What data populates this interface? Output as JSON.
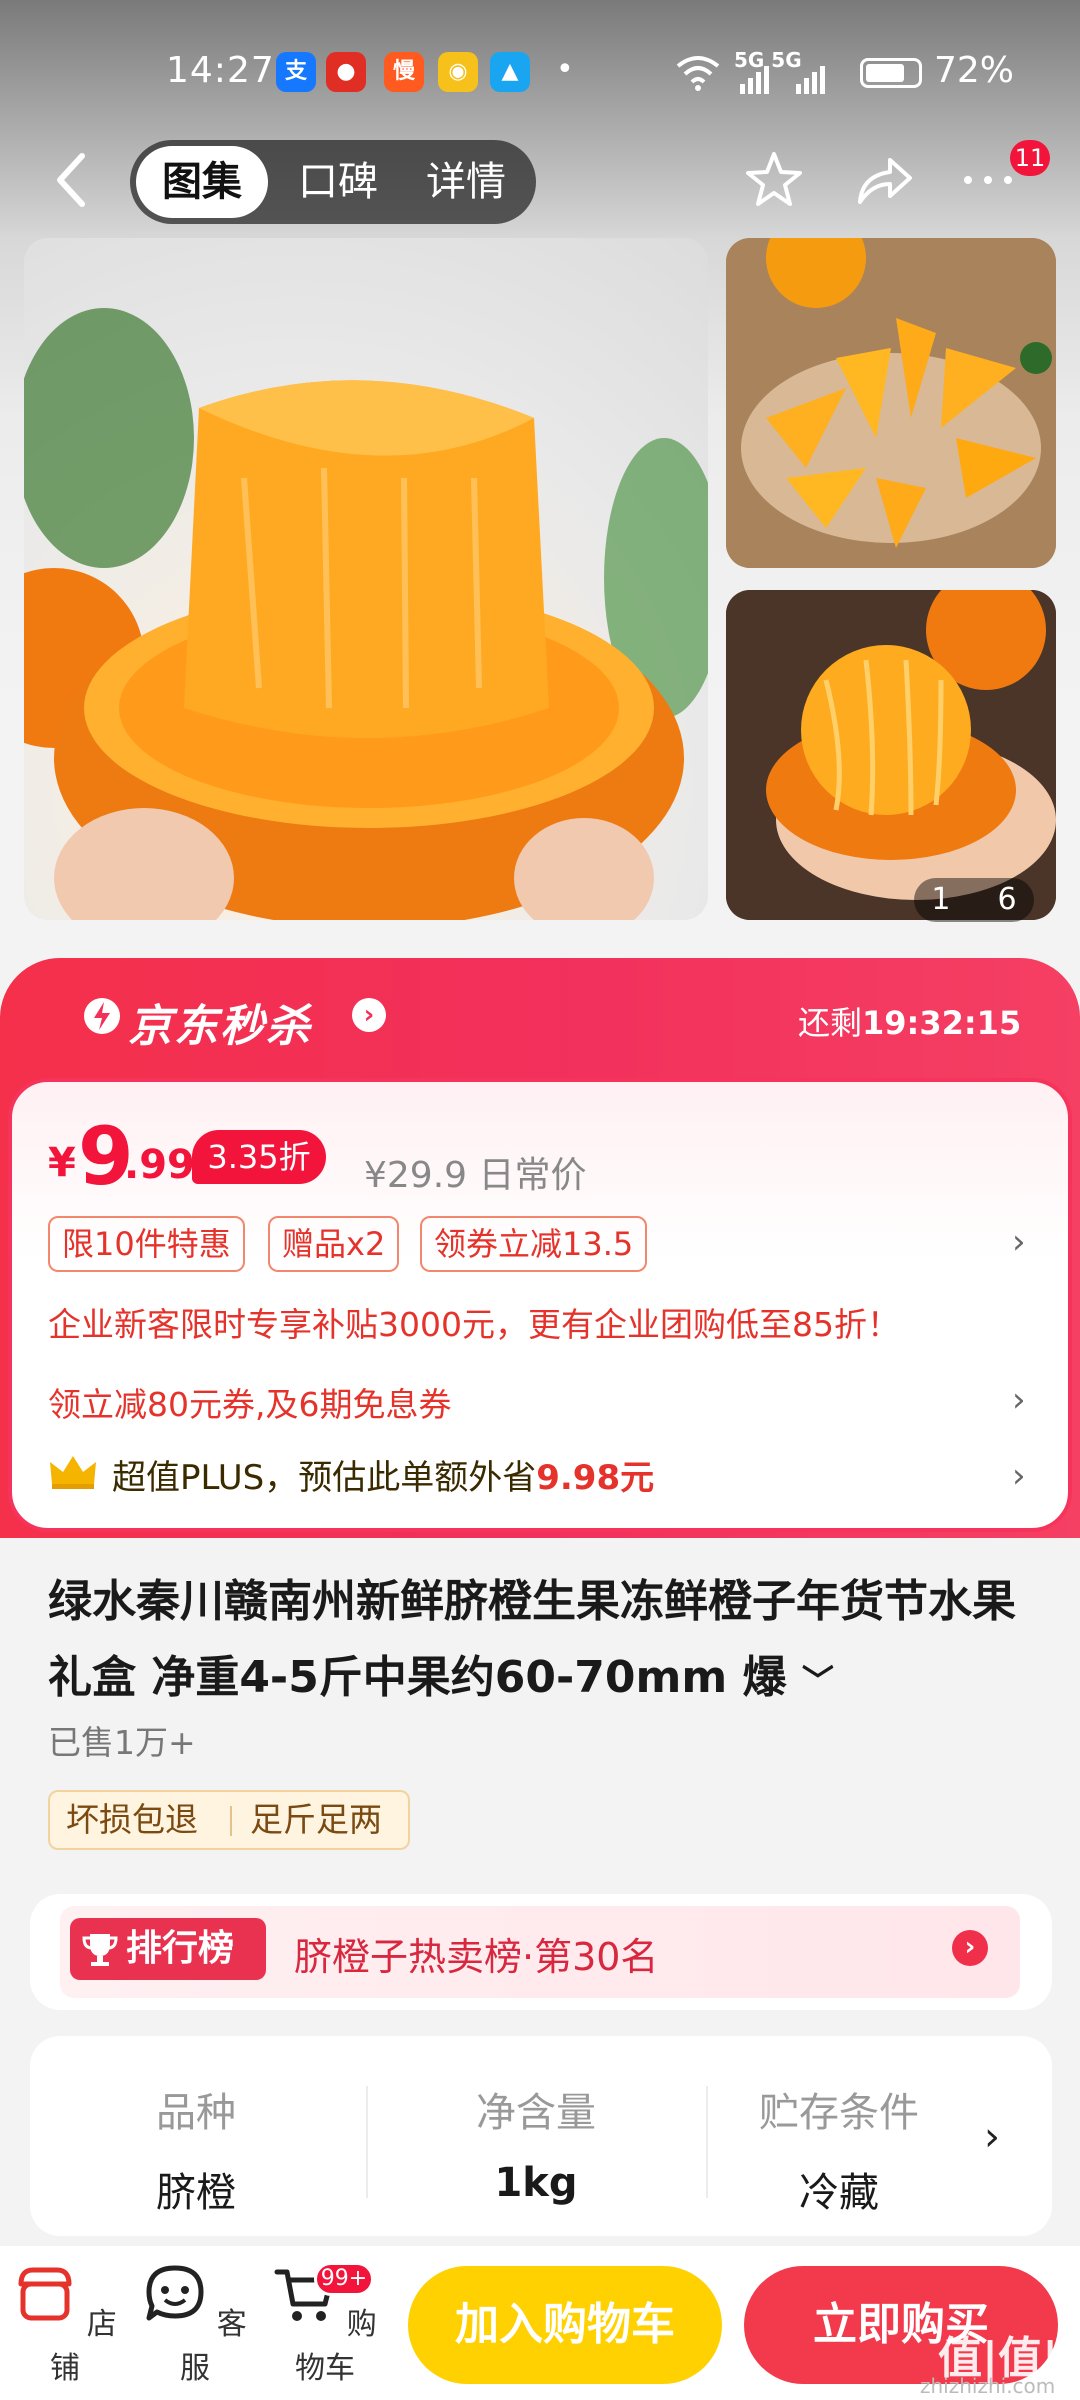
{
  "status_bar": {
    "time": "14:27",
    "app_icons": [
      {
        "name": "alipay-icon",
        "glyph": "支",
        "color": "#1677ff"
      },
      {
        "name": "pinduoduo-icon",
        "glyph": "●",
        "color": "#e02e24"
      },
      {
        "name": "manmanbuy-icon",
        "glyph": "慢",
        "color": "#ff5a1f"
      },
      {
        "name": "weibo-icon",
        "glyph": "◉",
        "color": "#f5c11a"
      },
      {
        "name": "camel-icon",
        "glyph": "▲",
        "color": "#1aa5f0"
      }
    ],
    "dot": "•",
    "signal": "5G  5G",
    "battery": "72%"
  },
  "nav": {
    "tabs": [
      {
        "label": "图集",
        "active": true
      },
      {
        "label": "口碑",
        "active": false
      },
      {
        "label": "详情",
        "active": false
      }
    ],
    "message_badge": "11"
  },
  "gallery": {
    "counter_current": "1",
    "counter_total": "6"
  },
  "flash_sale": {
    "title": "京东秒杀",
    "remaining_label": "还剩",
    "countdown": "19:32:15"
  },
  "price": {
    "currency": "¥",
    "integer": "9",
    "decimal": ".99",
    "discount": "3.35折",
    "original": "¥29.9 日常价",
    "tags": [
      "限10件特惠",
      "赠品x2",
      "领券立减13.5"
    ],
    "promo_enterprise": "企业新客限时专享补贴3000元，更有企业团购低至85折！",
    "promo_coupon": "领立减80元券,及6期免息券",
    "plus_prefix": "超值PLUS，预估此单额外省",
    "plus_amount": "9.98元"
  },
  "product": {
    "title": "绿水秦川赣南州新鲜脐橙生果冻鲜橙子年货节水果礼盒 净重4-5斤中果约60-70mm 爆",
    "sold": "已售1万+",
    "services": [
      "坏损包退",
      "足斤足两"
    ]
  },
  "ranking": {
    "badge": "排行榜",
    "text": "脐橙子热卖榜·第30名"
  },
  "specs": [
    {
      "key": "品种",
      "value": "脐橙"
    },
    {
      "key": "净含量",
      "value": "1kg"
    },
    {
      "key": "贮存条件",
      "value": "冷藏"
    }
  ],
  "bottom_bar": {
    "shop": "店铺",
    "service": "客服",
    "cart": "购物车",
    "cart_badge": "99+",
    "add_to_cart": "加入购物车",
    "buy_now": "立即购买"
  },
  "watermark": {
    "text": "值|值|值",
    "sub": "zhizhizhi.com"
  },
  "colors": {
    "accent_red": "#f2143a",
    "flash_red": "#f2305a",
    "cart_yellow": "#ffd100",
    "buy_red": "#f23a4c"
  }
}
